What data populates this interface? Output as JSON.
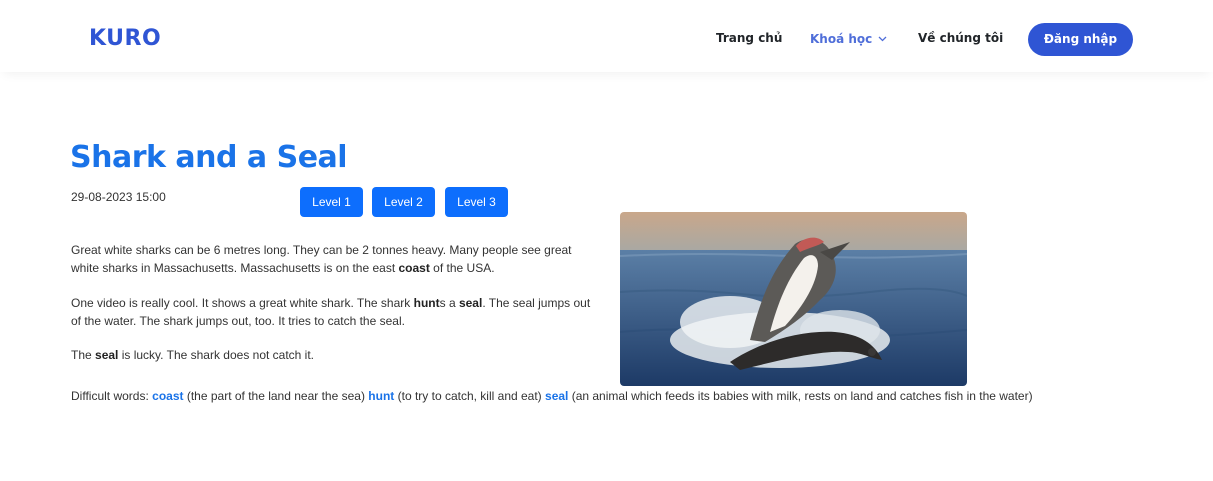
{
  "header": {
    "logo": "KURO",
    "nav": {
      "home": "Trang chủ",
      "courses": "Khoá học",
      "about": "Về chúng tôi",
      "login": "Đăng nhập"
    }
  },
  "article": {
    "title": "Shark and a Seal",
    "date": "29-08-2023 15:00",
    "levels": [
      "Level 1",
      "Level 2",
      "Level 3"
    ],
    "paragraphs": {
      "p1_a": "Great white sharks can be 6 metres long. They can be 2 tonnes heavy. Many people see great white sharks in Massachusetts. Massachusetts is on the east ",
      "p1_b": "coast",
      "p1_c": " of the USA.",
      "p2_a": "One video is really cool. It shows a great white shark. The shark ",
      "p2_b": "hunt",
      "p2_c": "s a ",
      "p2_d": "seal",
      "p2_e": ". The seal jumps out of the water. The shark jumps out, too. It tries to catch the seal.",
      "p3_a": "The ",
      "p3_b": "seal",
      "p3_c": " is lucky. The shark does not catch it."
    },
    "difficult": {
      "label": "Difficult words: ",
      "w1": "coast",
      "d1": " (the part of the land near the sea) ",
      "w2": "hunt",
      "d2": " (to try to catch, kill and eat) ",
      "w3": "seal",
      "d3": " (an animal which feeds its babies with milk, rests on land and catches fish in the water)"
    }
  },
  "colors": {
    "brand": "#2f55d4",
    "title": "#1a73e8",
    "level_button": "#0d6efd",
    "active_nav": "#4f6ed9"
  }
}
